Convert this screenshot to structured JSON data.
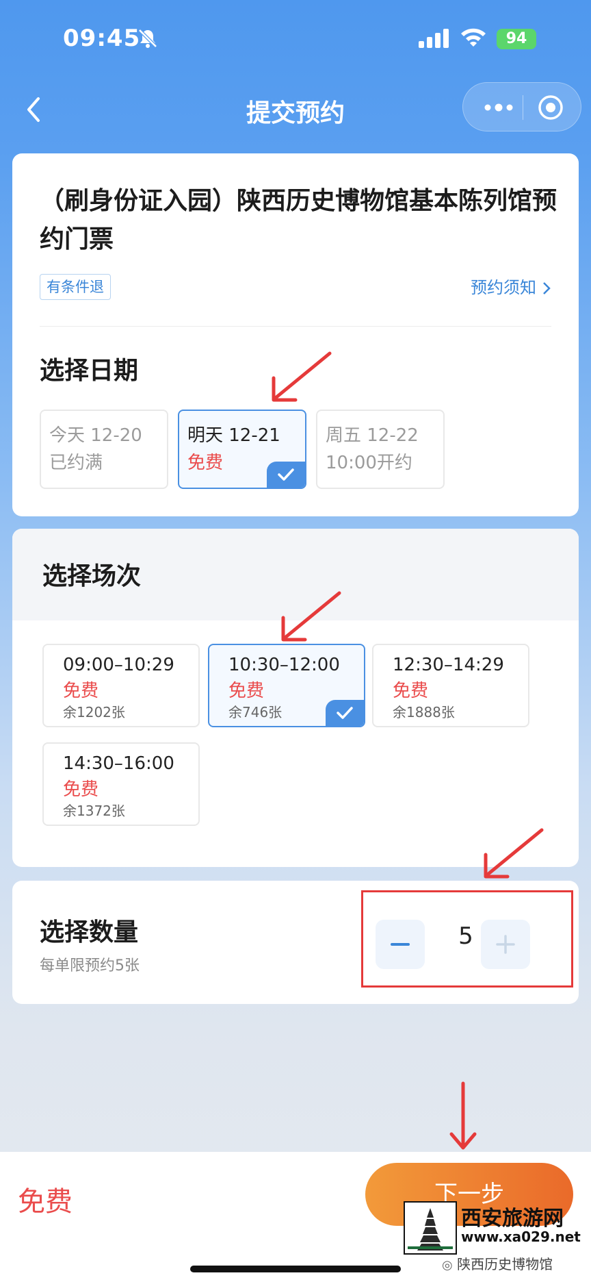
{
  "status_bar": {
    "time": "09:45",
    "battery": "94",
    "icons": [
      "bell-slash-icon",
      "signal-icon",
      "wifi-icon",
      "battery-icon"
    ]
  },
  "nav": {
    "title": "提交预约",
    "icons": [
      "chevron-left-icon",
      "more-icon",
      "target-icon"
    ]
  },
  "product": {
    "title": "（刷身份证入园）陕西历史博物馆基本陈列馆预约门票",
    "tag": "有条件退",
    "notice_link": "预约须知"
  },
  "date_section": {
    "title": "选择日期",
    "options": [
      {
        "label": "今天 12-20",
        "sub": "已约满",
        "selected": false
      },
      {
        "label": "明天 12-21",
        "sub": "免费",
        "selected": true
      },
      {
        "label": "周五 12-22",
        "sub": "10:00开约",
        "selected": false
      }
    ]
  },
  "session_section": {
    "title": "选择场次",
    "slots": [
      {
        "time": "09:00–10:29",
        "price": "免费",
        "remaining": "余1202张",
        "selected": false
      },
      {
        "time": "10:30–12:00",
        "price": "免费",
        "remaining": "余746张",
        "selected": true
      },
      {
        "time": "12:30–14:29",
        "price": "免费",
        "remaining": "余1888张",
        "selected": false
      },
      {
        "time": "14:30–16:00",
        "price": "免费",
        "remaining": "余1372张",
        "selected": false
      }
    ]
  },
  "quantity_section": {
    "title": "选择数量",
    "limit": "每单限预约5张",
    "value": "5"
  },
  "bottom_bar": {
    "price": "免费",
    "next_button": "下一步"
  },
  "watermark": {
    "name": "西安旅游网",
    "url": "www.xa029.net",
    "sub": "陕西历史博物馆"
  },
  "colors": {
    "accent": "#4a90e2",
    "price_red": "#ea4c4c",
    "button_orange": "#ee7a30",
    "annotation_red": "#e53a3a"
  }
}
